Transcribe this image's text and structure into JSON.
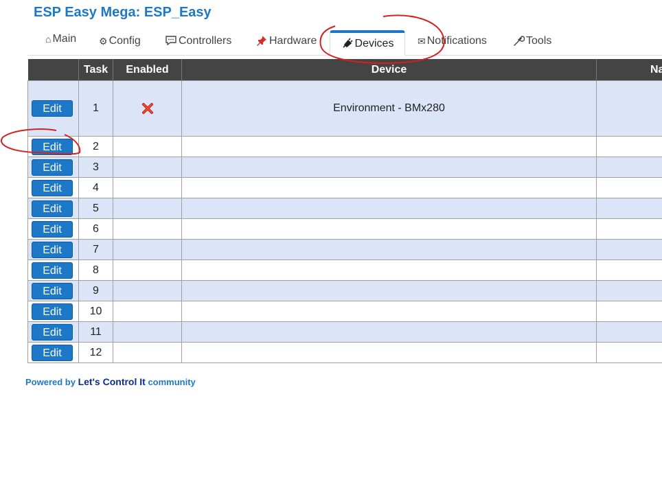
{
  "header": {
    "title": "ESP Easy Mega: ESP_Easy"
  },
  "menu": {
    "tabs": [
      {
        "label": "Main",
        "icon": "house-icon",
        "glyph": "⌂"
      },
      {
        "label": "Config",
        "icon": "gear-icon",
        "glyph": "⚙"
      },
      {
        "label": "Controllers",
        "icon": "speech-bubble-icon",
        "glyph": "💬"
      },
      {
        "label": "Hardware",
        "icon": "pushpin-icon",
        "glyph": "📌"
      },
      {
        "label": "Devices",
        "icon": "plug-icon",
        "glyph": "🔌",
        "active": true
      },
      {
        "label": "Notifications",
        "icon": "envelope-icon",
        "glyph": "✉"
      },
      {
        "label": "Tools",
        "icon": "wrench-icon",
        "glyph": "🔧"
      }
    ]
  },
  "table": {
    "headers": [
      "",
      "Task",
      "Enabled",
      "Device",
      "Na"
    ],
    "edit_label": "Edit",
    "rows": [
      {
        "task": "1",
        "enabled": "disabled",
        "device": "Environment - BMx280"
      },
      {
        "task": "2",
        "enabled": "",
        "device": ""
      },
      {
        "task": "3",
        "enabled": "",
        "device": ""
      },
      {
        "task": "4",
        "enabled": "",
        "device": ""
      },
      {
        "task": "5",
        "enabled": "",
        "device": ""
      },
      {
        "task": "6",
        "enabled": "",
        "device": ""
      },
      {
        "task": "7",
        "enabled": "",
        "device": ""
      },
      {
        "task": "8",
        "enabled": "",
        "device": ""
      },
      {
        "task": "9",
        "enabled": "",
        "device": ""
      },
      {
        "task": "10",
        "enabled": "",
        "device": ""
      },
      {
        "task": "11",
        "enabled": "",
        "device": ""
      },
      {
        "task": "12",
        "enabled": "",
        "device": ""
      }
    ]
  },
  "footer": {
    "prefix": "Powered by",
    "link": "Let's Control It",
    "suffix": "community"
  },
  "colors": {
    "accent": "#1e78c8",
    "header_bg": "#444444",
    "row_alt": "#dce4f8",
    "annotation": "#d42020",
    "disabled_x": "#e03020"
  }
}
